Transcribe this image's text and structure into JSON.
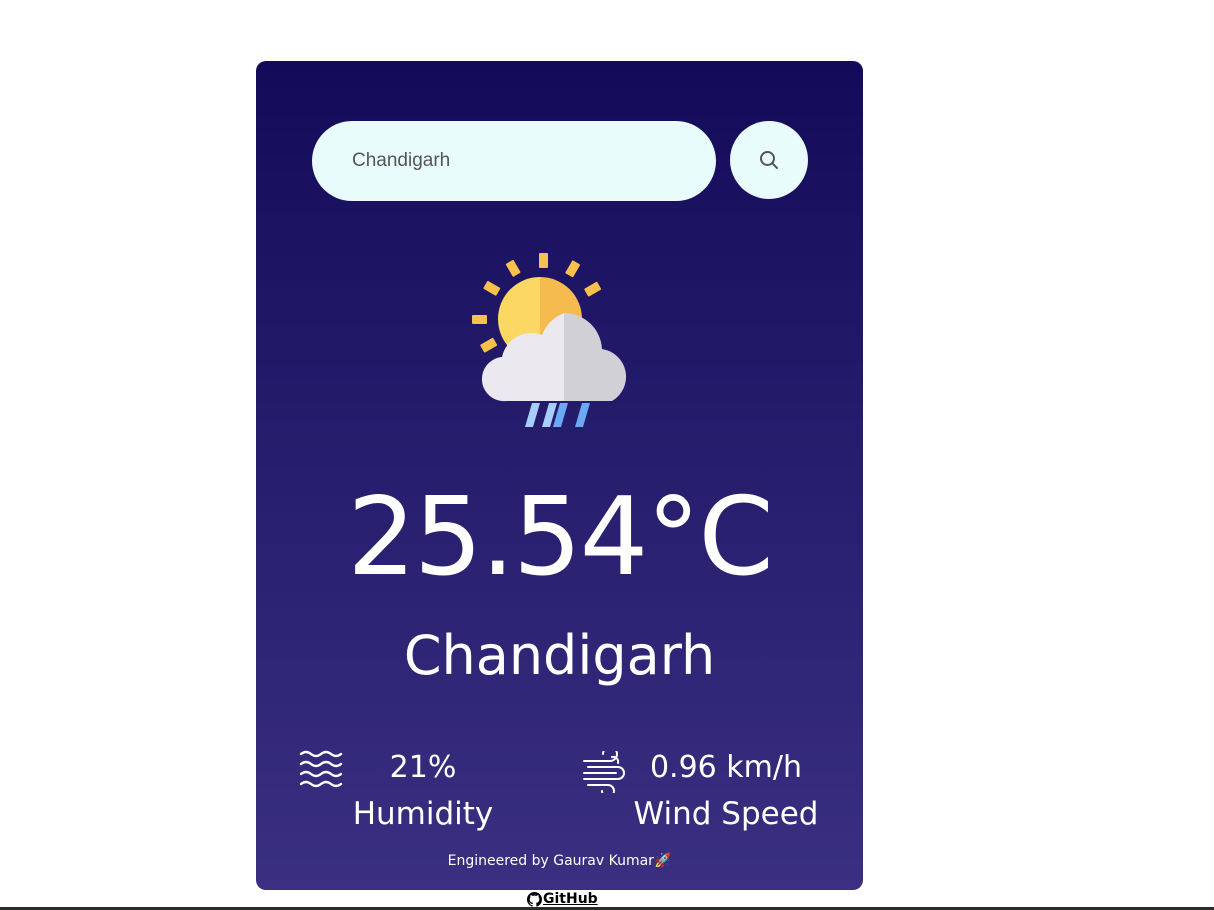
{
  "search": {
    "value": "Chandigarh",
    "placeholder": "",
    "button_icon": "search-icon"
  },
  "weather": {
    "icon": "sun-cloud-rain-icon",
    "temperature": "25.54°C",
    "city": "Chandigarh"
  },
  "stats": {
    "humidity": {
      "icon": "humidity-waves-icon",
      "value": "21%",
      "label": "Humidity"
    },
    "wind": {
      "icon": "wind-icon",
      "value": "0.96 km/h",
      "label": "Wind Speed"
    }
  },
  "footer": {
    "credit": "Engineered by Gaurav Kumar🚀",
    "github_label": "GitHub",
    "github_icon": "github-icon"
  },
  "colors": {
    "card_top": "#140a5a",
    "card_bottom": "#3a2f80",
    "input_bg": "#e8fcfb",
    "text": "#ffffff"
  }
}
